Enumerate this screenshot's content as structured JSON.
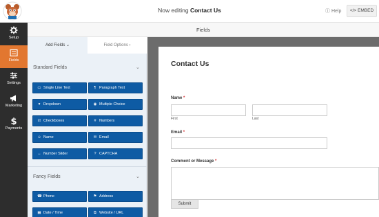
{
  "header": {
    "title_prefix": "Now editing",
    "title_form": "Contact Us",
    "help_label": "Help",
    "embed_label": "</> EMBED"
  },
  "nav": [
    {
      "label": "Setup",
      "icon": "gear-icon"
    },
    {
      "label": "Fields",
      "icon": "fields-icon",
      "active": true
    },
    {
      "label": "Settings",
      "icon": "sliders-icon"
    },
    {
      "label": "Marketing",
      "icon": "megaphone-icon"
    },
    {
      "label": "Payments",
      "icon": "dollar-icon"
    }
  ],
  "fields_header": "Fields",
  "panel": {
    "tab_add": "Add Fields ⌄",
    "tab_options": "Field Options ›",
    "standard_title": "Standard Fields",
    "fancy_title": "Fancy Fields",
    "standard": [
      {
        "label": "Single Line Text",
        "icon": "▭"
      },
      {
        "label": "Paragraph Text",
        "icon": "¶"
      },
      {
        "label": "Dropdown",
        "icon": "▾"
      },
      {
        "label": "Multiple Choice",
        "icon": "◉"
      },
      {
        "label": "Checkboxes",
        "icon": "☑"
      },
      {
        "label": "Numbers",
        "icon": "#"
      },
      {
        "label": "Name",
        "icon": "☺"
      },
      {
        "label": "Email",
        "icon": "✉"
      },
      {
        "label": "Number Slider",
        "icon": "↔"
      },
      {
        "label": "CAPTCHA",
        "icon": "?"
      }
    ],
    "fancy": [
      {
        "label": "Phone",
        "icon": "☎"
      },
      {
        "label": "Address",
        "icon": "⚑"
      },
      {
        "label": "Date / Time",
        "icon": "▦"
      },
      {
        "label": "Website / URL",
        "icon": "⧉"
      }
    ]
  },
  "form": {
    "title": "Contact Us",
    "name_label": "Name",
    "first_label": "First",
    "last_label": "Last",
    "email_label": "Email",
    "message_label": "Comment or Message",
    "required_mark": "*",
    "submit_label": "Submit"
  },
  "colors": {
    "accent": "#e27730",
    "field_button": "#0e5ba4",
    "nav_bg": "#2d2d2d",
    "preview_bg": "#6c6c6c"
  }
}
